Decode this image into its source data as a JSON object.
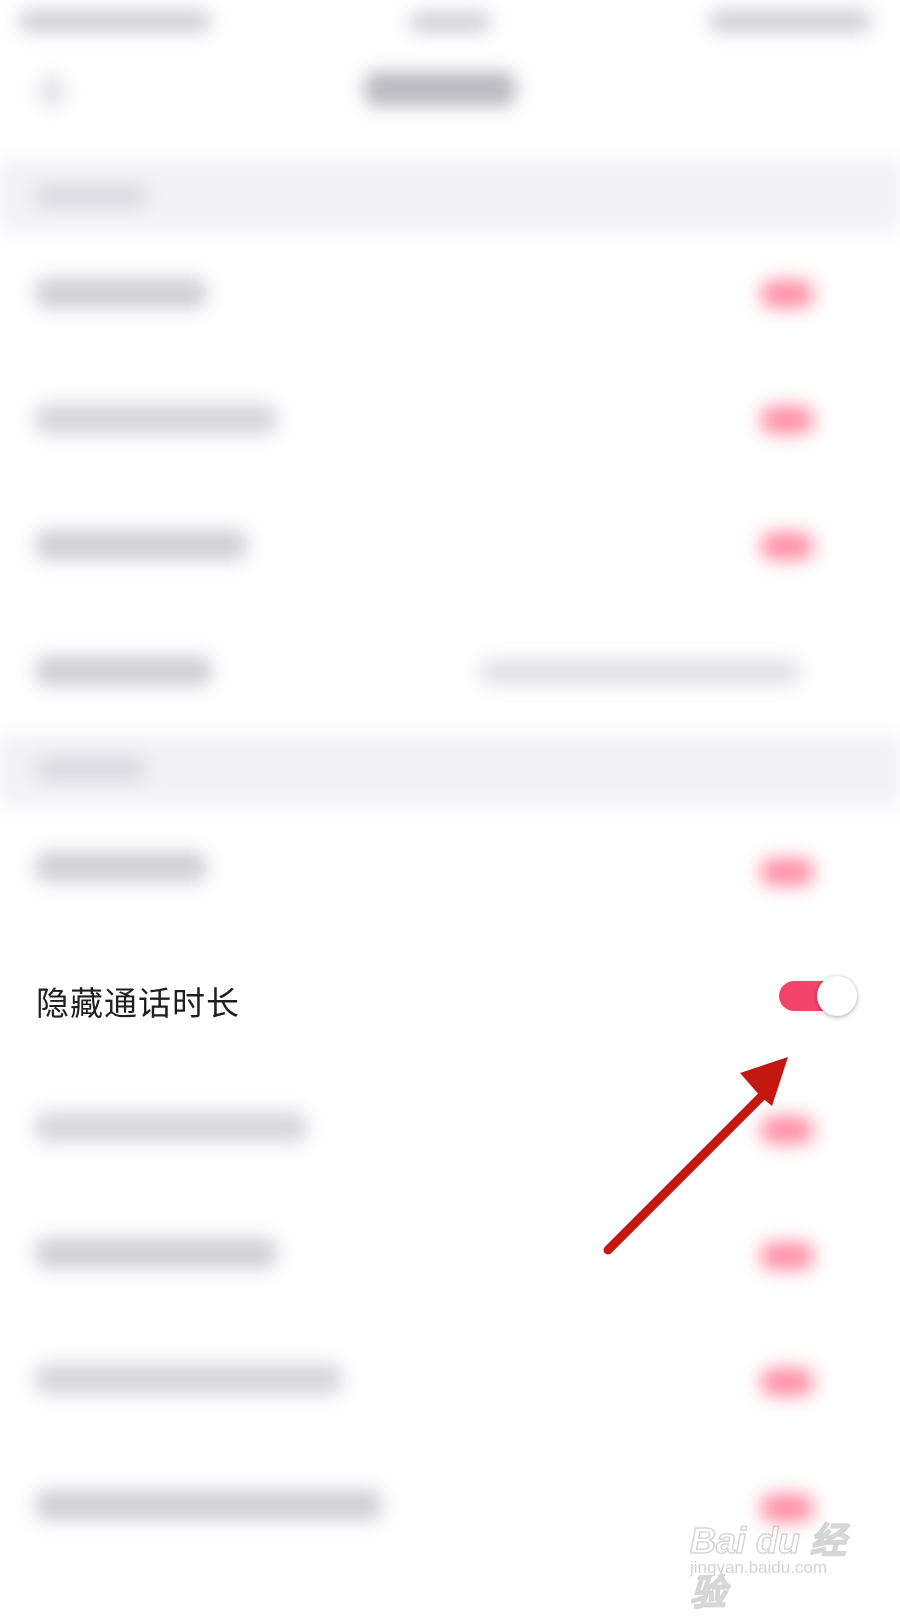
{
  "focused_row": {
    "label": "隐藏通话时长",
    "toggle_on": true
  },
  "colors": {
    "toggle_on": "#f4446a",
    "toggle_knob": "#ffffff",
    "label": "#1f1f1f",
    "arrow": "#c4170f",
    "background": "#ffffff"
  },
  "watermark": {
    "brand": "Bai du 经验",
    "url": "jingyan.baidu.com"
  }
}
